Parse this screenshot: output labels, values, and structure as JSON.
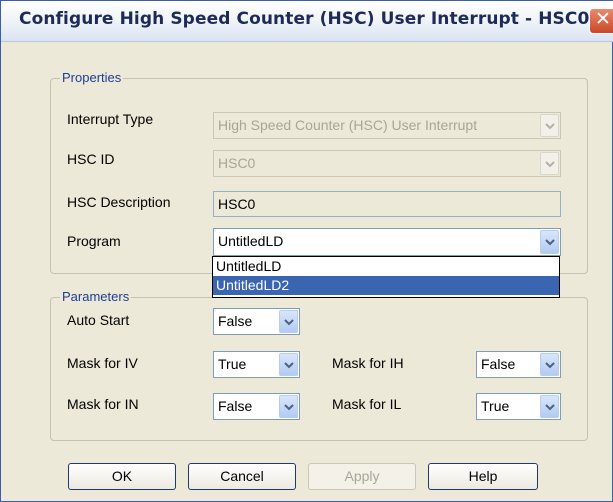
{
  "window": {
    "title": "Configure High Speed Counter (HSC) User Interrupt - HSC0",
    "close_glyph": "✕"
  },
  "properties": {
    "legend": "Properties",
    "interrupt_type": {
      "label": "Interrupt Type",
      "value": "High Speed Counter (HSC) User Interrupt",
      "enabled": false
    },
    "hsc_id": {
      "label": "HSC ID",
      "value": "HSC0",
      "enabled": false
    },
    "hsc_description": {
      "label": "HSC Description",
      "value": "HSC0"
    },
    "program": {
      "label": "Program",
      "value": "UntitledLD",
      "dropdown_open": true,
      "options": [
        "UntitledLD",
        "UntitledLD2"
      ],
      "highlighted_index": 1
    }
  },
  "parameters": {
    "legend": "Parameters",
    "auto_start": {
      "label": "Auto Start",
      "value": "False"
    },
    "mask_iv": {
      "label": "Mask for IV",
      "value": "True"
    },
    "mask_ih": {
      "label": "Mask for IH",
      "value": "False"
    },
    "mask_in": {
      "label": "Mask for IN",
      "value": "False"
    },
    "mask_il": {
      "label": "Mask for IL",
      "value": "True"
    }
  },
  "buttons": {
    "ok": "OK",
    "cancel": "Cancel",
    "apply": {
      "label": "Apply",
      "enabled": false
    },
    "help": "Help"
  },
  "icons": {
    "dropdown": "chevron-down-icon",
    "close": "close-icon"
  },
  "colors": {
    "title_text": "#1c2b57",
    "legend_text": "#1f3c95",
    "selection": "#3a65b0",
    "close_button": "#c84727",
    "dialog_bg": "#ece9d8"
  }
}
